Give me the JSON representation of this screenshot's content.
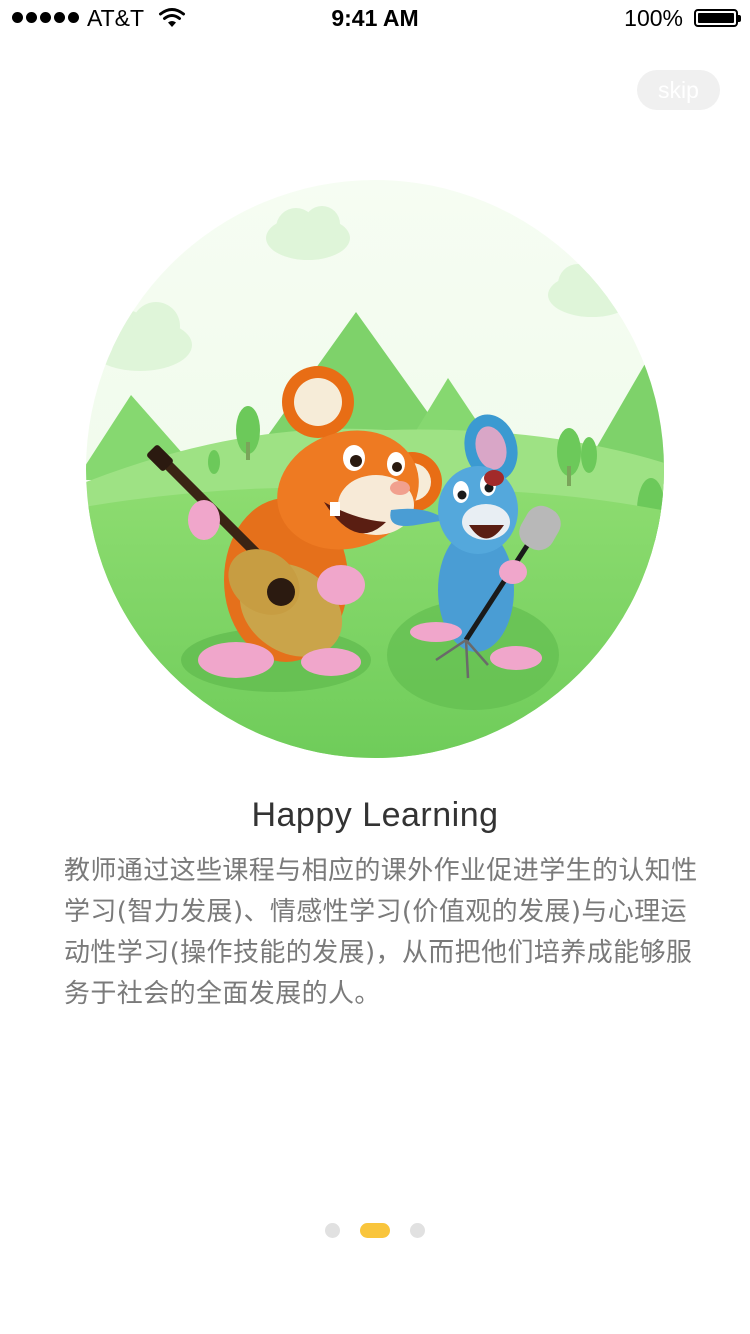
{
  "status_bar": {
    "carrier": "AT&T",
    "time": "9:41 AM",
    "battery": "100%",
    "icons": [
      "signal-dots-icon",
      "wifi-icon",
      "battery-icon"
    ]
  },
  "skip_label": "skip",
  "illustration": {
    "icon": "two-cartoon-mice-playing-guitar-and-singing"
  },
  "title": "Happy Learning",
  "description": "教师通过这些课程与相应的课外作业促进学生的认知性学习(智力发展)、情感性学习(价值观的发展)与心理运动性学习(操作技能的发展)，从而把他们培养成能够服务于社会的全面发展的人。",
  "pagination": {
    "count": 3,
    "current": 2
  },
  "colors": {
    "accent": "#f9c53c",
    "inactive_dot": "#e1e1e1",
    "grass": "#7dd466",
    "skip_bg": "#f0f0f0"
  }
}
